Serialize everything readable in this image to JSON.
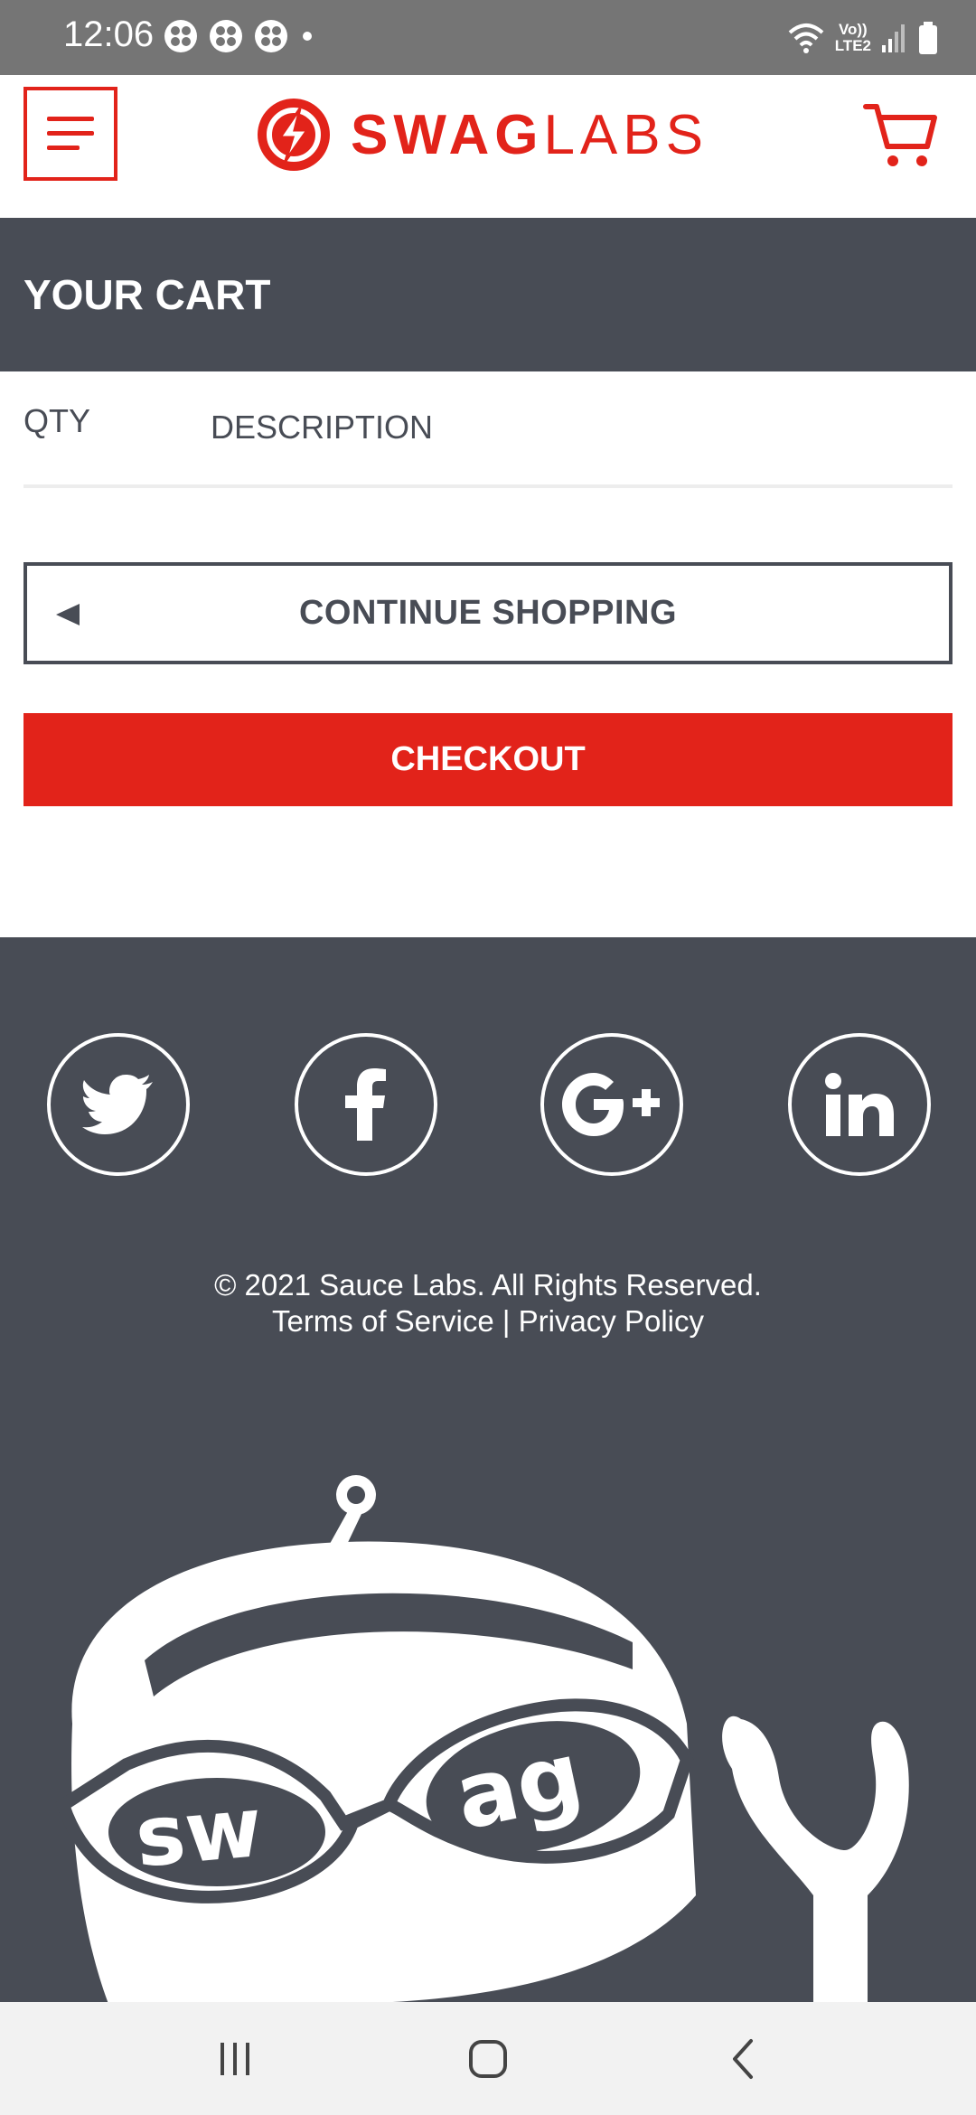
{
  "status_bar": {
    "time": "12:06",
    "network_label": "Vo))\nLTE2"
  },
  "header": {
    "logo_bold": "SWAG",
    "logo_light": "LABS",
    "menu_icon": "hamburger-menu-icon",
    "cart_icon": "shopping-cart-icon"
  },
  "page": {
    "title": "YOUR CART"
  },
  "cart": {
    "qty_header": "QTY",
    "description_header": "DESCRIPTION",
    "continue_label": "CONTINUE SHOPPING",
    "checkout_label": "CHECKOUT"
  },
  "footer": {
    "social": [
      "twitter-icon",
      "facebook-icon",
      "google-plus-icon",
      "linkedin-icon"
    ],
    "copyright": "© 2021 Sauce Labs. All Rights Reserved.",
    "terms_label": "Terms of Service",
    "separator": "|",
    "privacy_label": "Privacy Policy"
  },
  "colors": {
    "brand_red": "#e2231a",
    "dark_gray": "#484c55",
    "status_bar": "#757575",
    "nav_bar": "#f2f2f2"
  },
  "nav_bar": {
    "buttons": [
      "recent-apps-icon",
      "home-icon",
      "back-icon"
    ]
  }
}
